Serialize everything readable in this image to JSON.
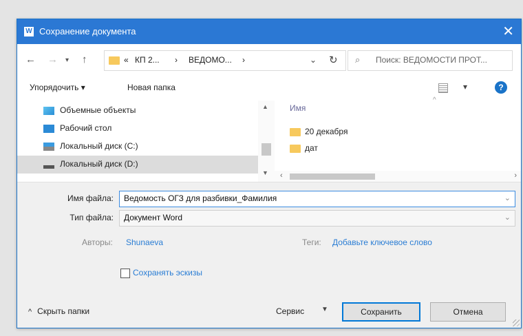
{
  "window": {
    "title": "Сохранение документа",
    "app_icon": "word-icon"
  },
  "nav": {
    "breadcrumb_prefix": "«",
    "breadcrumbs": [
      "КП 2...",
      "ВЕДОМО..."
    ],
    "breadcrumb_separator": "›",
    "search_placeholder": "Поиск: ВЕДОМОСТИ ПРОТ..."
  },
  "toolbar": {
    "organize_label": "Упорядочить ▾",
    "new_folder_label": "Новая папка",
    "view_dropdown": "▾",
    "help_label": "?"
  },
  "sidebar": {
    "items": [
      {
        "label": "Объемные объекты",
        "icon": "3d-objects-icon"
      },
      {
        "label": "Рабочий стол",
        "icon": "desktop-icon"
      },
      {
        "label": "Локальный диск (C:)",
        "icon": "drive-c-icon"
      },
      {
        "label": "Локальный диск (D:)",
        "icon": "drive-d-icon",
        "selected": true
      }
    ]
  },
  "files": {
    "column_name": "Имя",
    "items": [
      {
        "name": "20 декабря",
        "icon": "folder-icon"
      },
      {
        "name": "дат",
        "icon": "folder-icon"
      }
    ]
  },
  "form": {
    "filename_label": "Имя файла:",
    "filename_value": "Ведомость ОГЗ для разбивки_Фамилия",
    "filetype_label": "Тип файла:",
    "filetype_value": "Документ Word",
    "authors_label": "Авторы:",
    "authors_value": "Shunaeva",
    "tags_label": "Теги:",
    "tags_value": "Добавьте ключевое слово",
    "thumbnails_label": "Сохранять эскизы",
    "thumbnails_checked": false
  },
  "footer": {
    "hide_folders_label": "Скрыть папки",
    "service_label": "Сервис",
    "save_label": "Сохранить",
    "cancel_label": "Отмена"
  },
  "colors": {
    "title_bar": "#2b78d4",
    "link": "#2a7dd4",
    "folder": "#f7c95d"
  }
}
